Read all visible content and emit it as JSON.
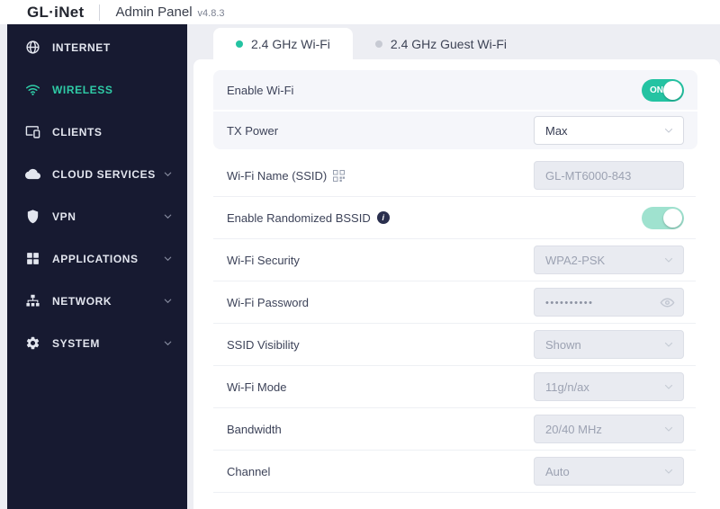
{
  "header": {
    "logo": "GL·iNet",
    "title": "Admin Panel",
    "version": "v4.8.3"
  },
  "sidebar": {
    "items": [
      {
        "label": "INTERNET",
        "icon": "globe-icon",
        "expandable": false,
        "active": false
      },
      {
        "label": "WIRELESS",
        "icon": "wifi-icon",
        "expandable": false,
        "active": true
      },
      {
        "label": "CLIENTS",
        "icon": "devices-icon",
        "expandable": false,
        "active": false
      },
      {
        "label": "CLOUD SERVICES",
        "icon": "cloud-icon",
        "expandable": true,
        "active": false
      },
      {
        "label": "VPN",
        "icon": "shield-icon",
        "expandable": true,
        "active": false
      },
      {
        "label": "APPLICATIONS",
        "icon": "apps-grid-icon",
        "expandable": true,
        "active": false
      },
      {
        "label": "NETWORK",
        "icon": "sitemap-icon",
        "expandable": true,
        "active": false
      },
      {
        "label": "SYSTEM",
        "icon": "gear-icon",
        "expandable": true,
        "active": false
      }
    ]
  },
  "tabs": [
    {
      "label": "2.4 GHz Wi-Fi",
      "active": true
    },
    {
      "label": "2.4 GHz Guest Wi-Fi",
      "active": false
    }
  ],
  "form": {
    "enable_wifi": {
      "label": "Enable Wi-Fi",
      "state": "ON"
    },
    "tx_power": {
      "label": "TX Power",
      "value": "Max"
    },
    "wifi_name": {
      "label": "Wi-Fi Name (SSID)",
      "value": "GL-MT6000-843"
    },
    "bssid": {
      "label": "Enable Randomized BSSID",
      "info_icon": "i",
      "state": "on-disabled"
    },
    "security": {
      "label": "Wi-Fi Security",
      "value": "WPA2-PSK"
    },
    "password": {
      "label": "Wi-Fi Password",
      "value": "••••••••••"
    },
    "visibility": {
      "label": "SSID Visibility",
      "value": "Shown"
    },
    "mode": {
      "label": "Wi-Fi Mode",
      "value": "11g/n/ax"
    },
    "bandwidth": {
      "label": "Bandwidth",
      "value": "20/40 MHz"
    },
    "channel": {
      "label": "Channel",
      "value": "Auto"
    }
  },
  "colors": {
    "accent": "#24c3a2",
    "accent_light": "#9fe2cf",
    "sidebar_bg": "#171a31",
    "page_bg": "#edeef3",
    "disabled_bg": "#e9ebf1"
  }
}
